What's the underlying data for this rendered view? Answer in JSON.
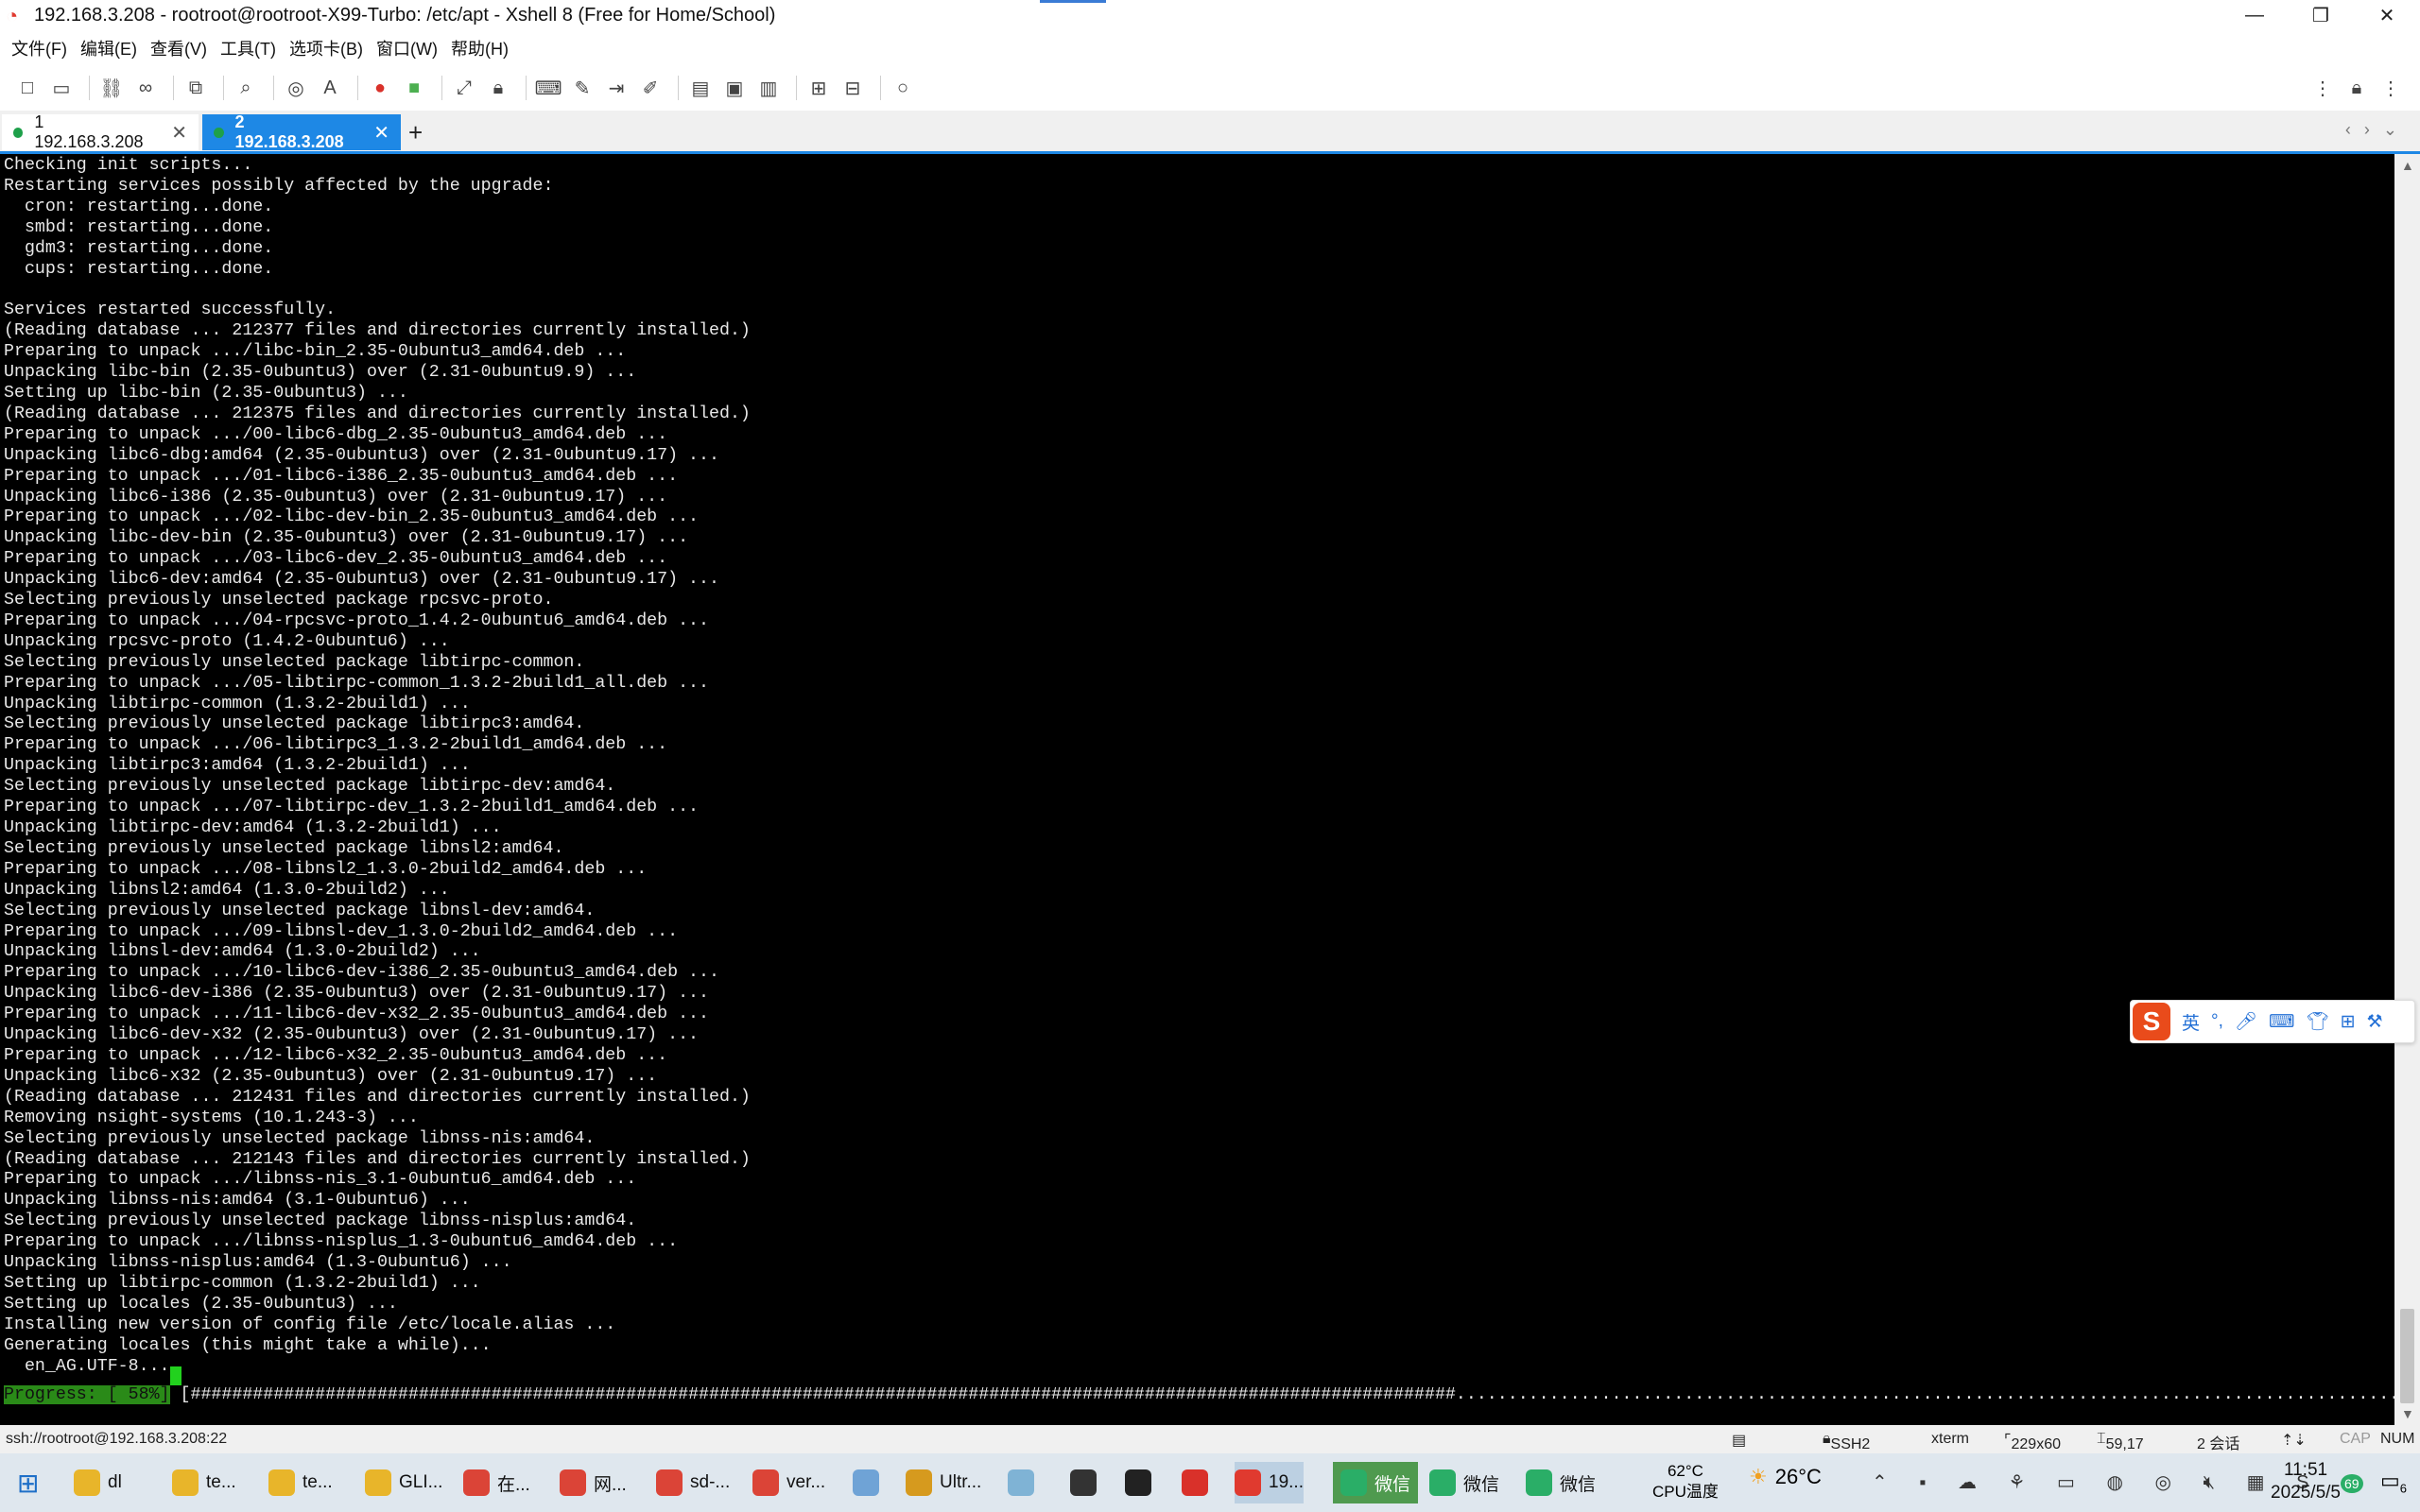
{
  "window": {
    "title": "192.168.3.208 - rootroot@rootroot-X99-Turbo: /etc/apt - Xshell 8 (Free for Home/School)",
    "app_icon": "xshell-logo-icon",
    "minimize": "—",
    "restore": "❐",
    "close": "✕"
  },
  "menu": [
    "文件(F)",
    "编辑(E)",
    "查看(V)",
    "工具(T)",
    "选项卡(B)",
    "窗口(W)",
    "帮助(H)"
  ],
  "tabs": [
    {
      "label": "1 192.168.3.208",
      "close": "✕",
      "status_color": "#1ea04a"
    },
    {
      "label": "2 192.168.3.208",
      "close": "✕",
      "status_color": "#1ea04a"
    }
  ],
  "tab_add": "+",
  "terminal": {
    "lines": [
      "Checking init scripts...",
      "Restarting services possibly affected by the upgrade:",
      "  cron: restarting...done.",
      "  smbd: restarting...done.",
      "  gdm3: restarting...done.",
      "  cups: restarting...done.",
      "",
      "Services restarted successfully.",
      "(Reading database ... 212377 files and directories currently installed.)",
      "Preparing to unpack .../libc-bin_2.35-0ubuntu3_amd64.deb ...",
      "Unpacking libc-bin (2.35-0ubuntu3) over (2.31-0ubuntu9.9) ...",
      "Setting up libc-bin (2.35-0ubuntu3) ...",
      "(Reading database ... 212375 files and directories currently installed.)",
      "Preparing to unpack .../00-libc6-dbg_2.35-0ubuntu3_amd64.deb ...",
      "Unpacking libc6-dbg:amd64 (2.35-0ubuntu3) over (2.31-0ubuntu9.17) ...",
      "Preparing to unpack .../01-libc6-i386_2.35-0ubuntu3_amd64.deb ...",
      "Unpacking libc6-i386 (2.35-0ubuntu3) over (2.31-0ubuntu9.17) ...",
      "Preparing to unpack .../02-libc-dev-bin_2.35-0ubuntu3_amd64.deb ...",
      "Unpacking libc-dev-bin (2.35-0ubuntu3) over (2.31-0ubuntu9.17) ...",
      "Preparing to unpack .../03-libc6-dev_2.35-0ubuntu3_amd64.deb ...",
      "Unpacking libc6-dev:amd64 (2.35-0ubuntu3) over (2.31-0ubuntu9.17) ...",
      "Selecting previously unselected package rpcsvc-proto.",
      "Preparing to unpack .../04-rpcsvc-proto_1.4.2-0ubuntu6_amd64.deb ...",
      "Unpacking rpcsvc-proto (1.4.2-0ubuntu6) ...",
      "Selecting previously unselected package libtirpc-common.",
      "Preparing to unpack .../05-libtirpc-common_1.3.2-2build1_all.deb ...",
      "Unpacking libtirpc-common (1.3.2-2build1) ...",
      "Selecting previously unselected package libtirpc3:amd64.",
      "Preparing to unpack .../06-libtirpc3_1.3.2-2build1_amd64.deb ...",
      "Unpacking libtirpc3:amd64 (1.3.2-2build1) ...",
      "Selecting previously unselected package libtirpc-dev:amd64.",
      "Preparing to unpack .../07-libtirpc-dev_1.3.2-2build1_amd64.deb ...",
      "Unpacking libtirpc-dev:amd64 (1.3.2-2build1) ...",
      "Selecting previously unselected package libnsl2:amd64.",
      "Preparing to unpack .../08-libnsl2_1.3.0-2build2_amd64.deb ...",
      "Unpacking libnsl2:amd64 (1.3.0-2build2) ...",
      "Selecting previously unselected package libnsl-dev:amd64.",
      "Preparing to unpack .../09-libnsl-dev_1.3.0-2build2_amd64.deb ...",
      "Unpacking libnsl-dev:amd64 (1.3.0-2build2) ...",
      "Preparing to unpack .../10-libc6-dev-i386_2.35-0ubuntu3_amd64.deb ...",
      "Unpacking libc6-dev-i386 (2.35-0ubuntu3) over (2.31-0ubuntu9.17) ...",
      "Preparing to unpack .../11-libc6-dev-x32_2.35-0ubuntu3_amd64.deb ...",
      "Unpacking libc6-dev-x32 (2.35-0ubuntu3) over (2.31-0ubuntu9.17) ...",
      "Preparing to unpack .../12-libc6-x32_2.35-0ubuntu3_amd64.deb ...",
      "Unpacking libc6-x32 (2.35-0ubuntu3) over (2.31-0ubuntu9.17) ...",
      "(Reading database ... 212431 files and directories currently installed.)",
      "Removing nsight-systems (10.1.243-3) ...",
      "Selecting previously unselected package libnss-nis:amd64.",
      "(Reading database ... 212143 files and directories currently installed.)",
      "Preparing to unpack .../libnss-nis_3.1-0ubuntu6_amd64.deb ...",
      "Unpacking libnss-nis:amd64 (3.1-0ubuntu6) ...",
      "Selecting previously unselected package libnss-nisplus:amd64.",
      "Preparing to unpack .../libnss-nisplus_1.3-0ubuntu6_amd64.deb ...",
      "Unpacking libnss-nisplus:amd64 (1.3-0ubuntu6) ...",
      "Setting up libtirpc-common (1.3.2-2build1) ...",
      "Setting up locales (2.35-0ubuntu3) ...",
      "Installing new version of config file /etc/locale.alias ...",
      "Generating locales (this might take a while)...",
      "  en_AG.UTF-8..."
    ],
    "progress_label": "Progress: [ 58%]",
    "progress_bar": "[##########################################################################################################################...........................................................................................]",
    "progress": 0.58
  },
  "ime": {
    "logo": "S",
    "lang": "英",
    "punct": "°,",
    "mic": "mic-icon",
    "keyboard": "keyboard-icon",
    "skin": "shirt-icon",
    "apps": "grid-icon",
    "tools": "toolbox-icon"
  },
  "statusbar": {
    "connection": "ssh://rootroot@192.168.3.208:22",
    "protocol": "SSH2",
    "terminal_type": "xterm",
    "size": "229x60",
    "cursor_pos": "59,17",
    "sessions": "2 会话",
    "cap": "CAP",
    "num": "NUM"
  },
  "taskbar": {
    "items": [
      {
        "label": "dl",
        "icon": "folder-icon",
        "color": "#e8b52a"
      },
      {
        "label": "te...",
        "icon": "folder-icon",
        "color": "#e8b52a"
      },
      {
        "label": "te...",
        "icon": "folder-icon",
        "color": "#e8b52a"
      },
      {
        "label": "GLI...",
        "icon": "folder-icon",
        "color": "#e8b52a"
      },
      {
        "label": "在...",
        "icon": "chrome-icon",
        "color": "#db4437"
      },
      {
        "label": "网...",
        "icon": "chrome-icon",
        "color": "#db4437"
      },
      {
        "label": "sd-...",
        "icon": "chrome-icon",
        "color": "#db4437"
      },
      {
        "label": "ver...",
        "icon": "chrome-icon",
        "color": "#db4437"
      },
      {
        "label": "",
        "icon": "paint-icon",
        "color": "#6fa3d6"
      },
      {
        "label": "Ultr...",
        "icon": "ultraedit-icon",
        "color": "#d69a1e"
      },
      {
        "label": "",
        "icon": "notepad-icon",
        "color": "#7fb3d5"
      },
      {
        "label": "",
        "icon": "obs-icon",
        "color": "#333333"
      },
      {
        "label": "",
        "icon": "terminal-icon",
        "color": "#222222"
      },
      {
        "label": "",
        "icon": "wps-icon",
        "color": "#d9312a"
      },
      {
        "label": "19...",
        "icon": "xshell-icon",
        "color": "#e03a2f"
      },
      {
        "label": "微信",
        "icon": "wechat-icon",
        "color": "#2aae67"
      },
      {
        "label": "微信",
        "icon": "wechat-icon",
        "color": "#2aae67"
      },
      {
        "label": "微信",
        "icon": "wechat-icon",
        "color": "#2aae67"
      }
    ],
    "cpu_temp_value": "62°C",
    "cpu_temp_label": "CPU温度",
    "weather": "26°C",
    "time": "11:51",
    "date": "2025/5/5",
    "notification_count": "6",
    "tray_battery": "69"
  }
}
